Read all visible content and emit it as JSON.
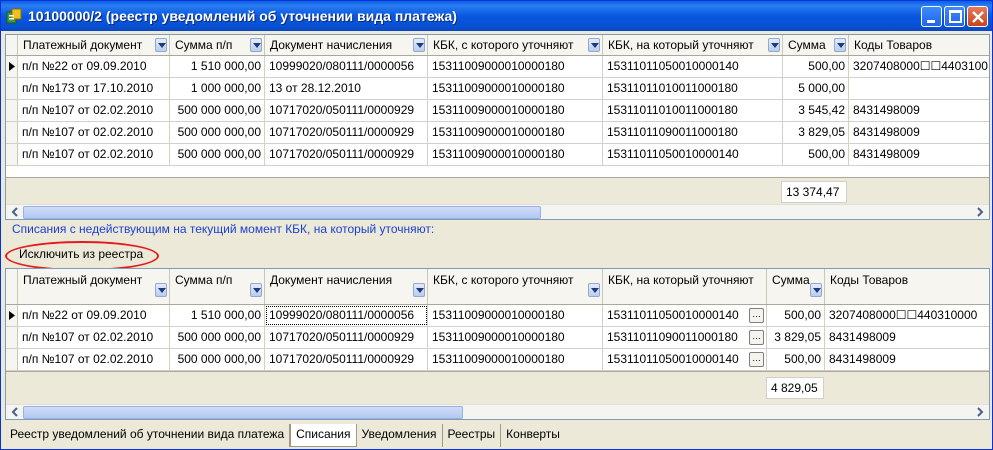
{
  "window": {
    "title": "10100000/2 (реестр уведомлений об уточнении вида платежа)"
  },
  "top_grid": {
    "columns": [
      "Платежный документ",
      "Сумма п/п",
      "Документ начисления",
      "КБК, с которого уточняют",
      "КБК, на который уточняют",
      "Сумма",
      "Коды Товаров"
    ],
    "rows": [
      [
        "п/п №22 от 09.09.2010",
        "1 510 000,00",
        "10999020/080111/0000056",
        "15311009000010000180",
        "15311011050010000140",
        "500,00",
        "3207408000☐☐4403100"
      ],
      [
        "п/п №173 от 17.10.2010",
        "1 000 000,00",
        "13 от 28.12.2010",
        "15311009000010000180",
        "15311011010011000180",
        "5 000,00",
        ""
      ],
      [
        "п/п №107 от 02.02.2010",
        "500 000 000,00",
        "10717020/050111/0000929",
        "15311009000010000180",
        "15311011010011000180",
        "3 545,42",
        "8431498009"
      ],
      [
        "п/п №107 от 02.02.2010",
        "500 000 000,00",
        "10717020/050111/0000929",
        "15311009000010000180",
        "15311011090011000180",
        "3 829,05",
        "8431498009"
      ],
      [
        "п/п №107 от 02.02.2010",
        "500 000 000,00",
        "10717020/050111/0000929",
        "15311009000010000180",
        "15311011050010000140",
        "500,00",
        "8431498009"
      ]
    ],
    "total": "13 374,47"
  },
  "section_label": "Списания с недействующим на текущий момент КБК, на который уточняют:",
  "exclude_button": "Исключить из реестра",
  "bottom_grid": {
    "columns": [
      "Платежный документ",
      "Сумма п/п",
      "Документ начисления",
      "КБК, с которого уточняют",
      "КБК, на который уточняют",
      "Сумма",
      "Коды Товаров"
    ],
    "rows": [
      [
        "п/п №22 от 09.09.2010",
        "1 510 000,00",
        "10999020/080111/0000056",
        "15311009000010000180",
        "15311011050010000140",
        "500,00",
        "3207408000☐☐440310000"
      ],
      [
        "п/п №107 от 02.02.2010",
        "500 000 000,00",
        "10717020/050111/0000929",
        "15311009000010000180",
        "15311011090011000180",
        "3 829,05",
        "8431498009"
      ],
      [
        "п/п №107 от 02.02.2010",
        "500 000 000,00",
        "10717020/050111/0000929",
        "15311009000010000180",
        "15311011050010000140",
        "500,00",
        "8431498009"
      ]
    ],
    "total": "4 829,05"
  },
  "tabs": [
    "Реестр уведомлений об уточнении вида платежа",
    "Списания",
    "Уведомления",
    "Реестры",
    "Конверты"
  ],
  "active_tab": "Списания",
  "colors": {
    "title_bar": "#0857e0",
    "section_label": "#1c3fd4",
    "highlight_ellipse": "#e21b1b"
  }
}
